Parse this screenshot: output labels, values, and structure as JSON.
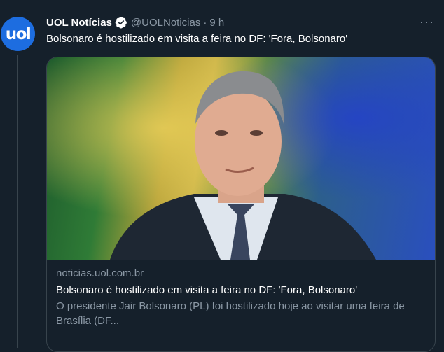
{
  "account": {
    "avatar_text": "uol",
    "name": "UOL Notícias",
    "handle": "@UOLNoticias",
    "separator": "·",
    "time": "9 h"
  },
  "tweet": {
    "text": "Bolsonaro é hostilizado em visita a feira no DF: 'Fora, Bolsonaro'"
  },
  "card": {
    "domain": "noticias.uol.com.br",
    "title": "Bolsonaro é hostilizado em visita a feira no DF: 'Fora, Bolsonaro'",
    "description": "O presidente Jair Bolsonaro (PL) foi hostilizado hoje ao visitar uma feira de Brasília (DF..."
  },
  "more_menu": "···",
  "colors": {
    "background": "#15202b",
    "border": "#38444d",
    "secondary_text": "#8b98a5",
    "avatar_blue": "#1d6de0",
    "verified_blue": "#ffffff"
  }
}
